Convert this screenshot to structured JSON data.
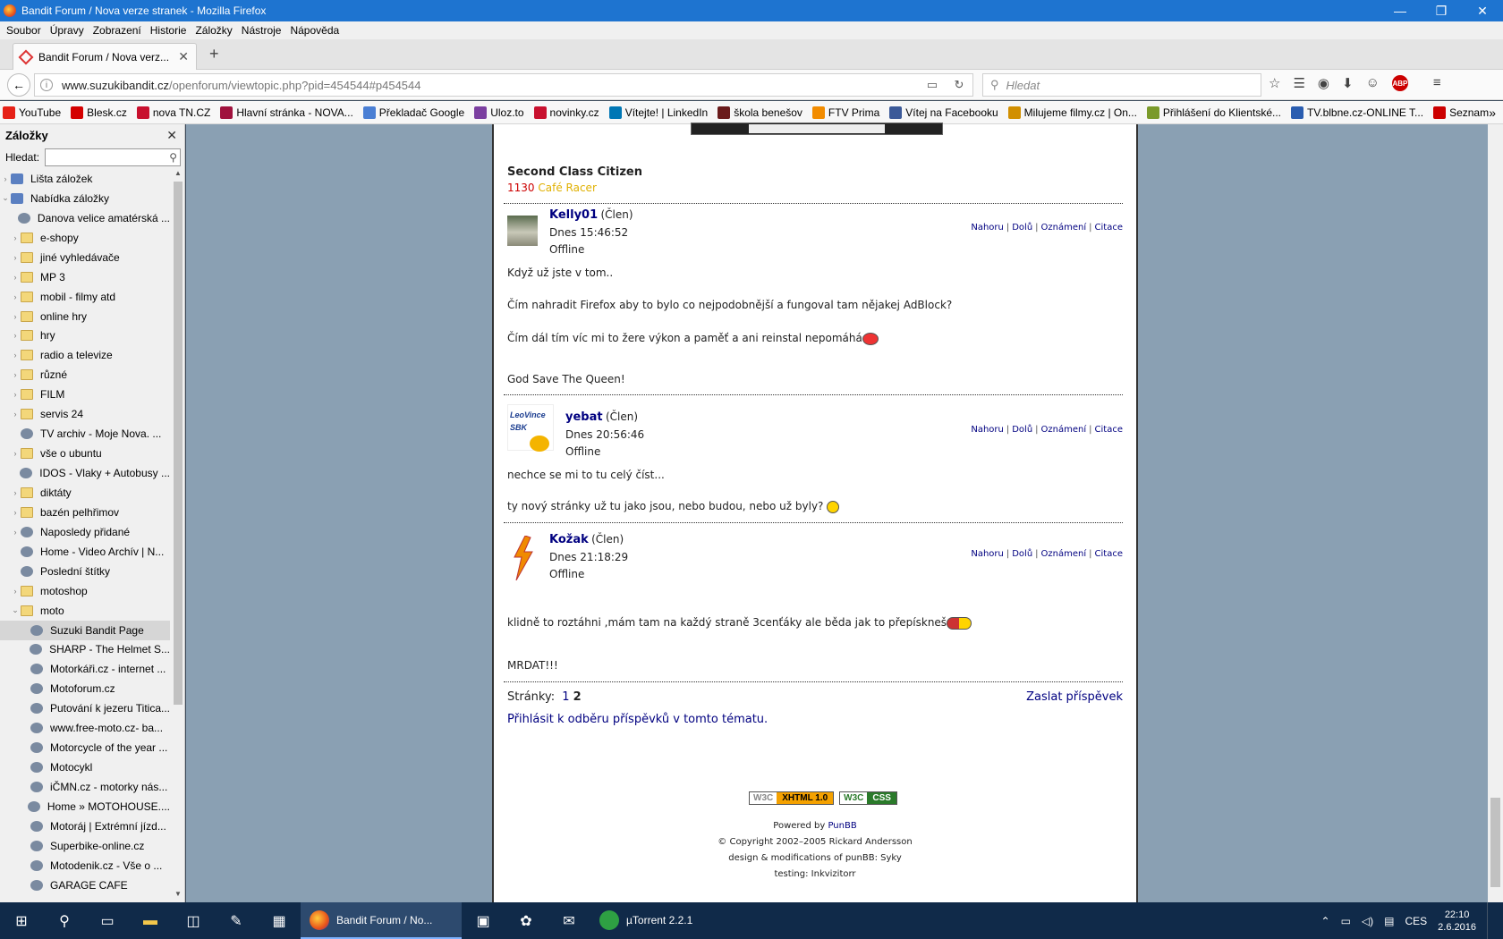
{
  "window": {
    "title": "Bandit Forum / Nova verze stranek - Mozilla Firefox"
  },
  "menu": [
    "Soubor",
    "Úpravy",
    "Zobrazení",
    "Historie",
    "Záložky",
    "Nástroje",
    "Nápověda"
  ],
  "tab": {
    "title": "Bandit Forum / Nova verz..."
  },
  "url": {
    "domain": "www.suzukibandit.cz",
    "path": "/openforum/viewtopic.php?pid=454544#p454544"
  },
  "search": {
    "placeholder": "Hledat"
  },
  "bookmarks_bar": [
    {
      "label": "YouTube",
      "color": "#e62117"
    },
    {
      "label": "Blesk.cz",
      "color": "#d40000"
    },
    {
      "label": "nova TN.CZ",
      "color": "#c8102e"
    },
    {
      "label": "Hlavní stránka - NOVA...",
      "color": "#a0123d"
    },
    {
      "label": "Překladač Google",
      "color": "#4a7fd4"
    },
    {
      "label": "Uloz.to",
      "color": "#7b3fa0"
    },
    {
      "label": "novinky.cz",
      "color": "#c8102e"
    },
    {
      "label": "Vítejte! | LinkedIn",
      "color": "#0077b5"
    },
    {
      "label": "škola benešov",
      "color": "#6a1b1b"
    },
    {
      "label": "FTV Prima",
      "color": "#f28c00"
    },
    {
      "label": "Vítej na Facebooku",
      "color": "#3b5998"
    },
    {
      "label": "Milujeme filmy.cz | On...",
      "color": "#d18f00"
    },
    {
      "label": "Přihlášení do Klientské...",
      "color": "#7a9a2a"
    },
    {
      "label": "TV.blbne.cz-ONLINE T...",
      "color": "#2a5db0"
    },
    {
      "label": "Seznam",
      "color": "#cc0000"
    }
  ],
  "sidebar": {
    "title": "Záložky",
    "search_label": "Hledat:",
    "items": [
      {
        "label": "Lišta záložek",
        "type": "lst",
        "tw": "›",
        "indent": 0
      },
      {
        "label": "Nabídka záložky",
        "type": "lst",
        "tw": "⌄",
        "indent": 0
      },
      {
        "label": "Danova velice amatérská ...",
        "type": "page",
        "tw": "",
        "indent": 1
      },
      {
        "label": "e-shopy",
        "type": "folder",
        "tw": "›",
        "indent": 1
      },
      {
        "label": "jiné vyhledávače",
        "type": "folder",
        "tw": "›",
        "indent": 1
      },
      {
        "label": "MP 3",
        "type": "folder",
        "tw": "›",
        "indent": 1
      },
      {
        "label": "mobil - filmy atd",
        "type": "folder",
        "tw": "›",
        "indent": 1
      },
      {
        "label": "online hry",
        "type": "folder",
        "tw": "›",
        "indent": 1
      },
      {
        "label": "hry",
        "type": "folder",
        "tw": "›",
        "indent": 1
      },
      {
        "label": "radio a televize",
        "type": "folder",
        "tw": "›",
        "indent": 1
      },
      {
        "label": "různé",
        "type": "folder",
        "tw": "›",
        "indent": 1
      },
      {
        "label": "FILM",
        "type": "folder",
        "tw": "›",
        "indent": 1
      },
      {
        "label": "servis 24",
        "type": "folder",
        "tw": "›",
        "indent": 1
      },
      {
        "label": "TV archiv - Moje Nova. ...",
        "type": "page",
        "tw": "",
        "indent": 1
      },
      {
        "label": "vše o ubuntu",
        "type": "folder",
        "tw": "›",
        "indent": 1
      },
      {
        "label": "IDOS - Vlaky + Autobusy ...",
        "type": "page",
        "tw": "",
        "indent": 1
      },
      {
        "label": "diktáty",
        "type": "folder",
        "tw": "›",
        "indent": 1
      },
      {
        "label": "bazén pelhřimov",
        "type": "folder",
        "tw": "›",
        "indent": 1
      },
      {
        "label": "Naposledy přidané",
        "type": "page",
        "tw": "›",
        "indent": 1
      },
      {
        "label": "Home - Video Archív | N...",
        "type": "page",
        "tw": "",
        "indent": 1
      },
      {
        "label": "Poslední štítky",
        "type": "page",
        "tw": "",
        "indent": 1
      },
      {
        "label": "motoshop",
        "type": "folder",
        "tw": "›",
        "indent": 1
      },
      {
        "label": "moto",
        "type": "folder",
        "tw": "⌄",
        "indent": 1
      },
      {
        "label": "Suzuki Bandit Page",
        "type": "page",
        "tw": "",
        "indent": 2,
        "sel": true
      },
      {
        "label": "SHARP - The Helmet S...",
        "type": "page",
        "tw": "",
        "indent": 2
      },
      {
        "label": "Motorkáři.cz - internet ...",
        "type": "page",
        "tw": "",
        "indent": 2
      },
      {
        "label": "Motoforum.cz",
        "type": "page",
        "tw": "",
        "indent": 2
      },
      {
        "label": "Putování k jezeru Titica...",
        "type": "page",
        "tw": "",
        "indent": 2
      },
      {
        "label": "www.free-moto.cz- ba...",
        "type": "page",
        "tw": "",
        "indent": 2
      },
      {
        "label": "Motorcycle of the year ...",
        "type": "page",
        "tw": "",
        "indent": 2
      },
      {
        "label": "Motocykl",
        "type": "page",
        "tw": "",
        "indent": 2
      },
      {
        "label": "iČMN.cz - motorky nás...",
        "type": "page",
        "tw": "",
        "indent": 2
      },
      {
        "label": "Home » MOTOHOUSE....",
        "type": "page",
        "tw": "",
        "indent": 2
      },
      {
        "label": "Motoráj | Extrémní jízd...",
        "type": "page",
        "tw": "",
        "indent": 2
      },
      {
        "label": "Superbike-online.cz",
        "type": "page",
        "tw": "",
        "indent": 2
      },
      {
        "label": "Motodenik.cz - Vše o ...",
        "type": "page",
        "tw": "",
        "indent": 2
      },
      {
        "label": "GARAGE CAFE",
        "type": "page",
        "tw": "",
        "indent": 2
      }
    ]
  },
  "forum": {
    "sig_name": "Second Class Citizen",
    "sig_num": "1130",
    "sig_model": "Café Racer",
    "post_links": [
      "Nahoru",
      "Dolů",
      "Oznámení",
      "Citace"
    ],
    "posts": [
      {
        "user": "Kelly01",
        "role": "(Člen)",
        "time": "Dnes 15:46:52",
        "status": "Offline",
        "lines": [
          "Když už jste v tom..",
          "Čím nahradit Firefox aby to bylo co nejpodobnější a fungoval tam nějakej AdBlock?",
          "Čím dál tím víc mi to žere výkon a paměť a ani reinstal nepomáhá"
        ],
        "sig": "God Save The Queen!"
      },
      {
        "user": "yebat",
        "role": "(Člen)",
        "time": "Dnes 20:56:46",
        "status": "Offline",
        "lines": [
          "nechce se mi to tu celý číst...",
          "ty nový stránky už tu jako jsou, nebo budou, nebo už byly?"
        ],
        "avatar_text": "LeoVince SBK"
      },
      {
        "user": "Kožak",
        "role": "(Člen)",
        "time": "Dnes 21:18:29",
        "status": "Offline",
        "lines": [
          "klidně to roztáhni ,mám tam na každý straně 3cenťáky ale běda jak to přepískneš"
        ],
        "sig": "MRDAT!!!"
      }
    ],
    "pages_label": "Stránky:",
    "page1": "1",
    "page2": "2",
    "reply": "Zaslat příspěvek",
    "subscribe": "Přihlásit k odběru příspěvků v tomto tématu.",
    "w3c1": "W3C",
    "w3c1b": "XHTML 1.0",
    "w3c2": "W3C",
    "w3c2b": "CSS",
    "powered": "Powered by",
    "punbb": "PunBB",
    "copyright": "© Copyright 2002–2005 Rickard Andersson",
    "design": "design & modifications of punBB: Syky",
    "testing": "testing: Inkvizitorr"
  },
  "taskbar": {
    "apps": [
      {
        "label": "Bandit Forum / No...",
        "active": true
      },
      {
        "label": "µTorrent 2.2.1",
        "active": false
      }
    ],
    "lang": "CES",
    "time": "22:10",
    "date": "2.6.2016"
  }
}
